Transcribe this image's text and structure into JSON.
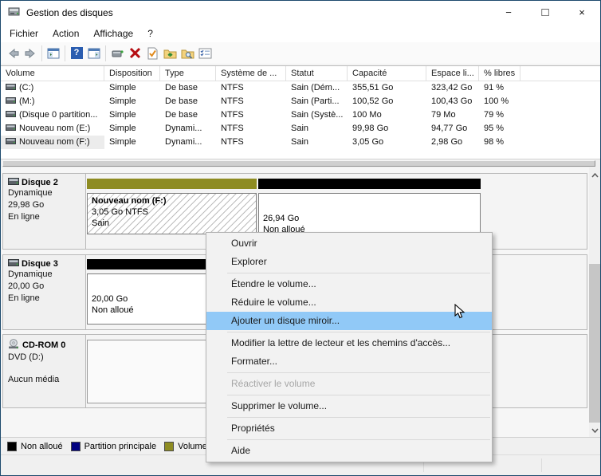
{
  "window": {
    "title": "Gestion des disques",
    "controls": {
      "minimize": "−",
      "maximize": "□",
      "close": "×"
    }
  },
  "menubar": {
    "items": [
      "Fichier",
      "Action",
      "Affichage",
      "?"
    ]
  },
  "toolbar": {
    "help_glyph": "?",
    "icons": [
      "back",
      "forward",
      "show-console-tree",
      "help",
      "show-action-pane",
      "popup-window",
      "delete",
      "validate",
      "folder-up",
      "folder-search",
      "checklist"
    ]
  },
  "volume_table": {
    "columns": [
      "Volume",
      "Disposition",
      "Type",
      "Système de ...",
      "Statut",
      "Capacité",
      "Espace li...",
      "% libres"
    ],
    "rows": [
      {
        "volume": "(C:)",
        "disposition": "Simple",
        "type": "De base",
        "systeme": "NTFS",
        "statut": "Sain (Dém...",
        "capacite": "355,51 Go",
        "espace": "323,42 Go",
        "libres": "91 %"
      },
      {
        "volume": "(M:)",
        "disposition": "Simple",
        "type": "De base",
        "systeme": "NTFS",
        "statut": "Sain (Parti...",
        "capacite": "100,52 Go",
        "espace": "100,43 Go",
        "libres": "100 %"
      },
      {
        "volume": "(Disque 0 partition...",
        "disposition": "Simple",
        "type": "De base",
        "systeme": "NTFS",
        "statut": "Sain (Systè...",
        "capacite": "100 Mo",
        "espace": "79 Mo",
        "libres": "79 %"
      },
      {
        "volume": "Nouveau nom (E:)",
        "disposition": "Simple",
        "type": "Dynami...",
        "systeme": "NTFS",
        "statut": "Sain",
        "capacite": "99,98 Go",
        "espace": "94,77 Go",
        "libres": "95 %"
      },
      {
        "volume": "Nouveau nom (F:)",
        "disposition": "Simple",
        "type": "Dynami...",
        "systeme": "NTFS",
        "statut": "Sain",
        "capacite": "3,05 Go",
        "espace": "2,98 Go",
        "libres": "98 %"
      }
    ]
  },
  "disks": [
    {
      "name": "Disque 2",
      "kind": "Dynamique",
      "size": "29,98 Go",
      "status": "En ligne",
      "partitions": [
        {
          "title": "Nouveau nom  (F:)",
          "line2": "3,05 Go NTFS",
          "line3": "Sain",
          "bar_color": "#8e8c22",
          "selected": true
        },
        {
          "title": "",
          "line2": "26,94 Go",
          "line3": "Non alloué",
          "bar_color": "#000000"
        }
      ]
    },
    {
      "name": "Disque 3",
      "kind": "Dynamique",
      "size": "20,00 Go",
      "status": "En ligne",
      "partitions": [
        {
          "title": "",
          "line2": "20,00 Go",
          "line3": "Non alloué",
          "bar_color": "#000000"
        }
      ]
    },
    {
      "name": "CD-ROM 0",
      "kind": "DVD (D:)",
      "size": "",
      "status": "Aucun média",
      "partitions": []
    }
  ],
  "context_menu": {
    "items": [
      {
        "label": "Ouvrir"
      },
      {
        "label": "Explorer"
      },
      {
        "label": "Étendre le volume..."
      },
      {
        "label": "Réduire le volume..."
      },
      {
        "label": "Ajouter un disque miroir...",
        "highlighted": true
      },
      {
        "label": "Modifier la lettre de lecteur et les chemins d'accès..."
      },
      {
        "label": "Formater..."
      },
      {
        "label": "Réactiver le volume",
        "disabled": true
      },
      {
        "label": "Supprimer le volume..."
      },
      {
        "label": "Propriétés"
      },
      {
        "label": "Aide"
      }
    ]
  },
  "legend": {
    "items": [
      {
        "label": "Non alloué",
        "color": "#000000"
      },
      {
        "label": "Partition principale",
        "color": "#000080"
      },
      {
        "label": "Volume simple",
        "color": "#8e8c22"
      }
    ]
  },
  "colors": {
    "window_border": "#1d4a6d",
    "menu_highlight": "#91c9f7",
    "simple_volume": "#8e8c22",
    "unallocated": "#000000",
    "primary_partition": "#000080"
  }
}
